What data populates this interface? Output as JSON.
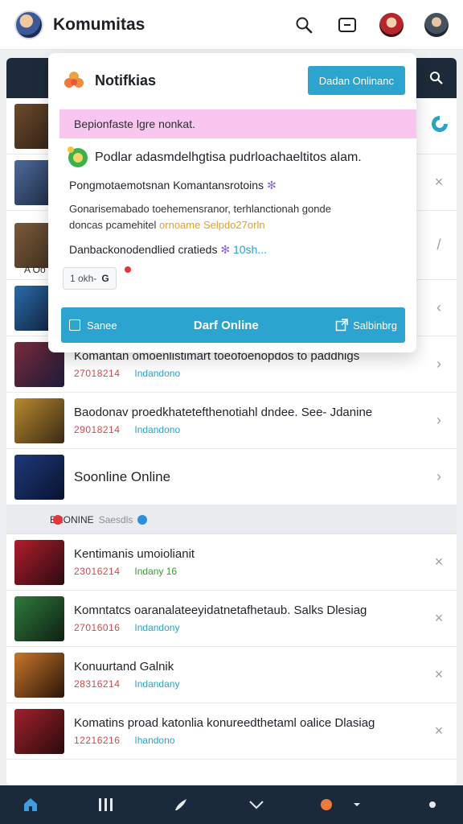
{
  "topbar": {
    "title": "Komumitas"
  },
  "notification": {
    "title": "Notifkias",
    "online_button": "Dadan Onlinanc",
    "banner": "Bepionfaste lgre nonkat.",
    "line1": "Podlar adasmdelhgtisa pudrloachaeltitos alam.",
    "line2": "Pongmotaemotsnan Komantansrotoins",
    "line3a": "Gonarisemabado toehemensranor, terhlanctionah gonde",
    "line3b": "doncas pcamehitel",
    "line3_highlight": "ornoame Selpdo27orln",
    "line4": "Danbackonodendlied cratieds",
    "line4_link": "10sh...",
    "chip_label": "1 okh-",
    "footer_left": "Sanee",
    "footer_center": "Darf Online",
    "footer_right": "Salbinbrg"
  },
  "list": {
    "side_label": "A Oo",
    "section_label": "BRONINE",
    "section_sub": "Saesdls",
    "rows": [
      {
        "title": "Komantan omoenlistimart toeofoenopdos to paddhigs",
        "date": "27018214",
        "tag": "Indandono"
      },
      {
        "title": "Baodonav proedkhatetefthenotiahl dndee. See- Jdanine",
        "date": "29018214",
        "tag": "Indandono"
      },
      {
        "title": "Soonline Online",
        "date": "",
        "tag": ""
      },
      {
        "title": "Kentimanis umoiolianit",
        "date": "23016214",
        "tag": "Indany 16"
      },
      {
        "title": "Komntatcs oaranalateeyidatnetafhetaub. Salks Dlesiag",
        "date": "27016016",
        "tag": "Indandony"
      },
      {
        "title": "Konuurtand Galnik",
        "date": "28316214",
        "tag": "Indandany"
      },
      {
        "title": "Komatins proad katonlia konureedthetaml oalice Dlasiag",
        "date": "12216216",
        "tag": "Ihandono"
      }
    ]
  },
  "colors": {
    "accent": "#2ba4cf",
    "banner": "#f8c6ee",
    "nav": "#1b2a3a",
    "date": "#d4464c"
  }
}
